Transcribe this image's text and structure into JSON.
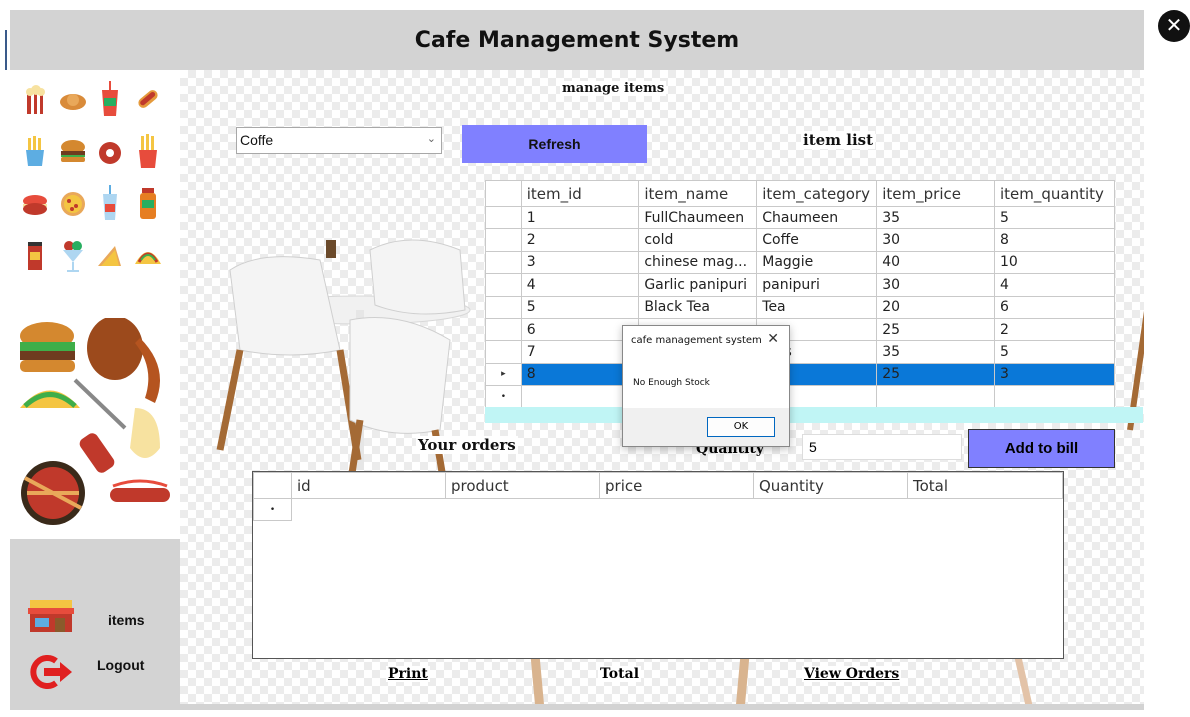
{
  "window": {
    "title": "Cafe Management System",
    "close_glyph": "✕"
  },
  "sidebar": {
    "items_label": "items",
    "logout_label": "Logout",
    "icons": [
      "popcorn-icon",
      "croissant-icon",
      "soda-cup-icon",
      "hotdog-icon",
      "fries-cup-icon",
      "burger-icon",
      "donut-icon",
      "fries-icon",
      "macaron-icon",
      "pizza-icon",
      "milkshake-icon",
      "jam-jar-icon",
      "coffee-cup-icon",
      "sundae-icon",
      "sandwich-icon",
      "taco-icon"
    ]
  },
  "manage": {
    "heading": "manage items",
    "category_value": "Coffe",
    "refresh_label": "Refresh",
    "item_list_label": "item list"
  },
  "items_table": {
    "columns": [
      "item_id",
      "item_name",
      "item_category",
      "item_price",
      "item_quantity"
    ],
    "rows": [
      [
        "1",
        "FullChaumeen",
        "Chaumeen",
        "35",
        "5"
      ],
      [
        "2",
        "cold",
        "Coffe",
        "30",
        "8"
      ],
      [
        "3",
        "chinese mag...",
        "Maggie",
        "40",
        "10"
      ],
      [
        "4",
        "Garlic panipuri",
        "panipuri",
        "30",
        "4"
      ],
      [
        "5",
        "Black Tea",
        "Tea",
        "20",
        "6"
      ],
      [
        "6",
        "",
        "",
        "25",
        "2"
      ],
      [
        "7",
        "",
        "mos",
        "35",
        "5"
      ],
      [
        "8",
        "",
        "",
        "25",
        "3"
      ]
    ],
    "selected_marker": "▸",
    "new_row_marker": "•"
  },
  "orders": {
    "heading": "Your orders",
    "quantity_label": "Quantity",
    "quantity_value": "5",
    "add_label": "Add to bill",
    "columns": [
      "id",
      "product",
      "price",
      "Quantity",
      "Total"
    ],
    "new_row_marker": "•"
  },
  "footer": {
    "print": "Print",
    "total": "Total",
    "view_orders": "View Orders"
  },
  "dialog": {
    "title": "cafe management system",
    "message": "No Enough Stock",
    "ok_label": "OK",
    "close_glyph": "✕"
  },
  "colors": {
    "accent": "#8080ff",
    "selection": "#0a78d8",
    "cyan": "#c0f5f5"
  }
}
